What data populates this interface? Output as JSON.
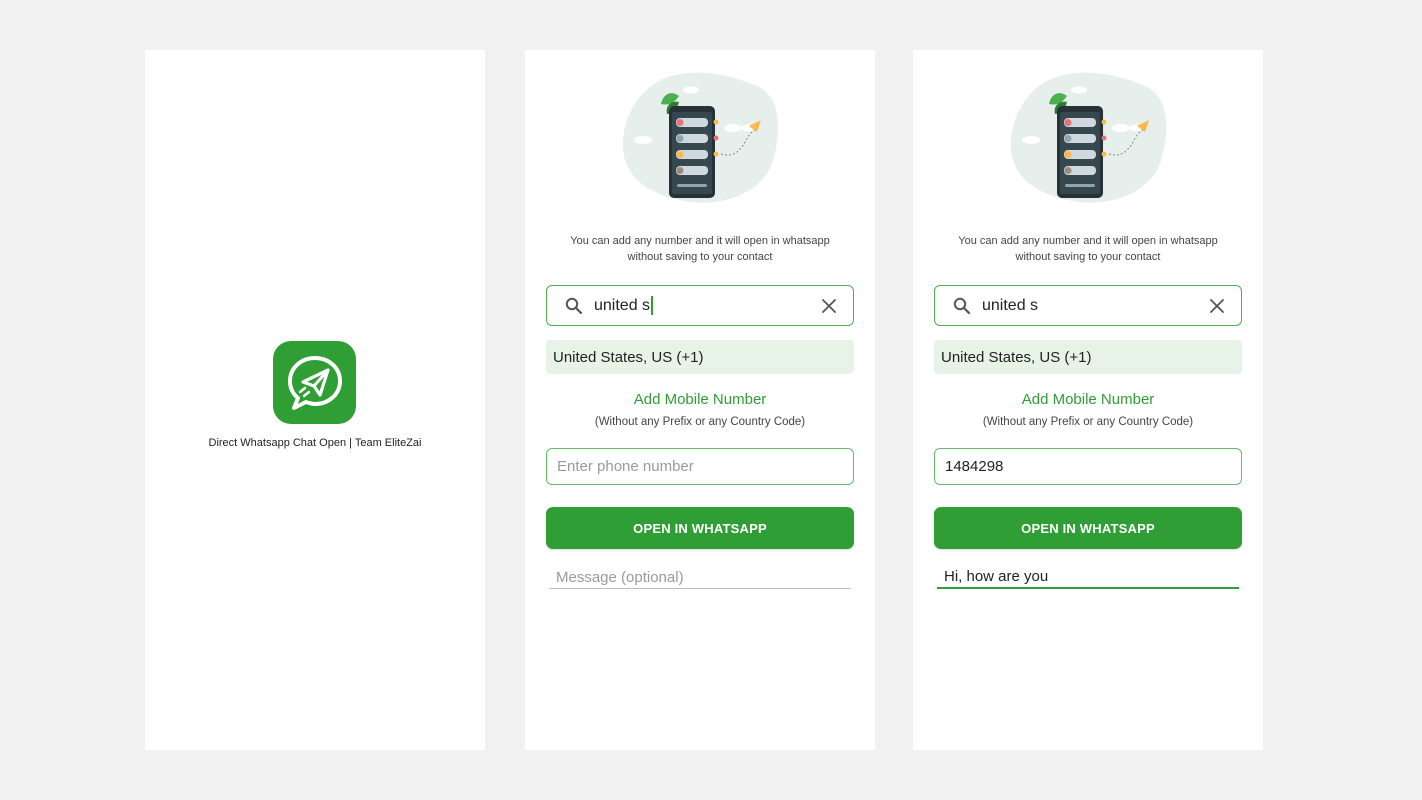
{
  "splash": {
    "app_icon": "paper-plane-chat-icon",
    "title": "Direct Whatsapp Chat Open | Team EliteZai"
  },
  "form_empty": {
    "info_line1": "You can add any number and it will open in whatsapp",
    "info_line2": "without saving to your contact",
    "search_value": "united s",
    "search_icon": "search-icon",
    "clear_icon": "close-icon",
    "country_result": "United States, US (+1)",
    "add_heading": "Add Mobile Number",
    "add_sub": "(Without any Prefix or any Country Code)",
    "phone_placeholder": "Enter phone number",
    "open_button": "OPEN IN WHATSAPP",
    "message_placeholder": "Message (optional)"
  },
  "form_filled": {
    "info_line1": "You can add any number and it will open in whatsapp",
    "info_line2": "without saving to your contact",
    "search_value": "united s",
    "search_icon": "search-icon",
    "clear_icon": "close-icon",
    "country_result": "United States, US (+1)",
    "add_heading": "Add Mobile Number",
    "add_sub": "(Without any Prefix or any Country Code)",
    "phone_value": "1484298",
    "open_button": "OPEN IN WHATSAPP",
    "message_value": "Hi, how are you"
  },
  "colors": {
    "accent": "#2f9e34",
    "background": "#f1f1f1",
    "result_bg": "#e8f3e8"
  }
}
